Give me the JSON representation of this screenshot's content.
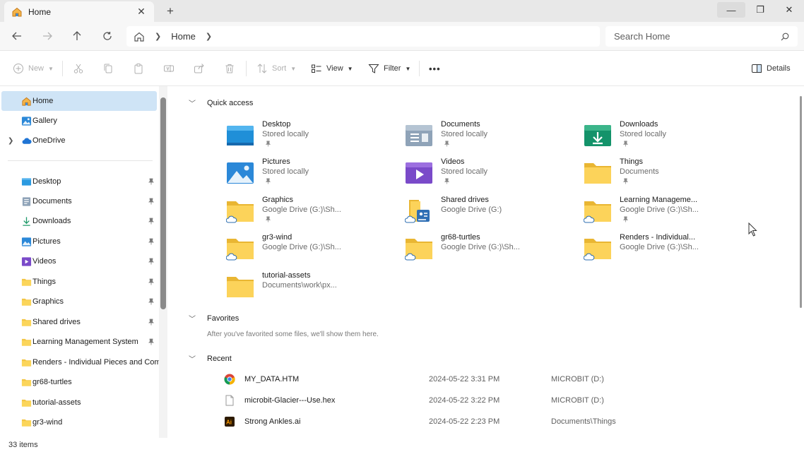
{
  "window": {
    "tab_title": "Home",
    "tab_icon": "home-icon",
    "new_tab_label": "+"
  },
  "address": {
    "breadcrumb": "Home",
    "search_placeholder": "Search Home"
  },
  "toolbar": {
    "new_label": "New",
    "sort_label": "Sort",
    "view_label": "View",
    "filter_label": "Filter",
    "more_label": "•••",
    "details_label": "Details"
  },
  "sidebar": {
    "top_items": [
      {
        "label": "Home",
        "icon": "home-icon",
        "selected": true
      },
      {
        "label": "Gallery",
        "icon": "gallery-icon"
      },
      {
        "label": "OneDrive",
        "icon": "cloud-icon"
      }
    ],
    "pinned_items": [
      {
        "label": "Desktop",
        "icon": "desktop-folder-icon"
      },
      {
        "label": "Documents",
        "icon": "documents-folder-icon"
      },
      {
        "label": "Downloads",
        "icon": "downloads-folder-icon"
      },
      {
        "label": "Pictures",
        "icon": "pictures-folder-icon"
      },
      {
        "label": "Videos",
        "icon": "videos-folder-icon"
      },
      {
        "label": "Things",
        "icon": "folder-icon"
      },
      {
        "label": "Graphics",
        "icon": "folder-icon"
      },
      {
        "label": "Shared drives",
        "icon": "folder-icon"
      },
      {
        "label": "Learning Management System",
        "icon": "folder-icon"
      },
      {
        "label": "Renders - Individual Pieces and Comp",
        "icon": "folder-icon"
      },
      {
        "label": "gr68-turtles",
        "icon": "folder-icon"
      },
      {
        "label": "tutorial-assets",
        "icon": "folder-icon"
      },
      {
        "label": "gr3-wind",
        "icon": "folder-icon"
      }
    ]
  },
  "quick_access": {
    "title": "Quick access",
    "tiles": [
      {
        "name": "Desktop",
        "sub": "Stored locally",
        "icon": "desktop-folder-icon"
      },
      {
        "name": "Documents",
        "sub": "Stored locally",
        "icon": "documents-folder-icon"
      },
      {
        "name": "Downloads",
        "sub": "Stored locally",
        "icon": "downloads-folder-icon"
      },
      {
        "name": "Pictures",
        "sub": "Stored locally",
        "icon": "pictures-folder-icon"
      },
      {
        "name": "Videos",
        "sub": "Stored locally",
        "icon": "videos-folder-icon"
      },
      {
        "name": "Things",
        "sub": "Documents",
        "icon": "folder-icon"
      },
      {
        "name": "Graphics",
        "sub": "Google Drive (G:)\\Sh...",
        "icon": "cloud-folder-icon"
      },
      {
        "name": "Shared drives",
        "sub": "Google Drive (G:)",
        "icon": "shared-drive-folder-icon"
      },
      {
        "name": "Learning Manageme...",
        "sub": "Google Drive (G:)\\Sh...",
        "icon": "cloud-folder-icon"
      },
      {
        "name": "gr3-wind",
        "sub": "Google Drive (G:)\\Sh...",
        "icon": "cloud-folder-icon"
      },
      {
        "name": "gr68-turtles",
        "sub": "Google Drive (G:)\\Sh...",
        "icon": "cloud-folder-icon"
      },
      {
        "name": "Renders - Individual...",
        "sub": "Google Drive (G:)\\Sh...",
        "icon": "cloud-folder-icon"
      },
      {
        "name": "tutorial-assets",
        "sub": "Documents\\work\\px...",
        "icon": "folder-icon"
      }
    ]
  },
  "favorites": {
    "title": "Favorites",
    "empty_text": "After you've favorited some files, we'll show them here."
  },
  "recent": {
    "title": "Recent",
    "rows": [
      {
        "name": "MY_DATA.HTM",
        "date": "2024-05-22 3:31 PM",
        "location": "MICROBIT (D:)",
        "icon": "chrome-icon"
      },
      {
        "name": "microbit-Glacier---Use.hex",
        "date": "2024-05-22 3:22 PM",
        "location": "MICROBIT (D:)",
        "icon": "file-icon"
      },
      {
        "name": "Strong Ankles.ai",
        "date": "2024-05-22 2:23 PM",
        "location": "Documents\\Things",
        "icon": "illustrator-icon"
      }
    ]
  },
  "status": {
    "item_count": "33 items"
  }
}
